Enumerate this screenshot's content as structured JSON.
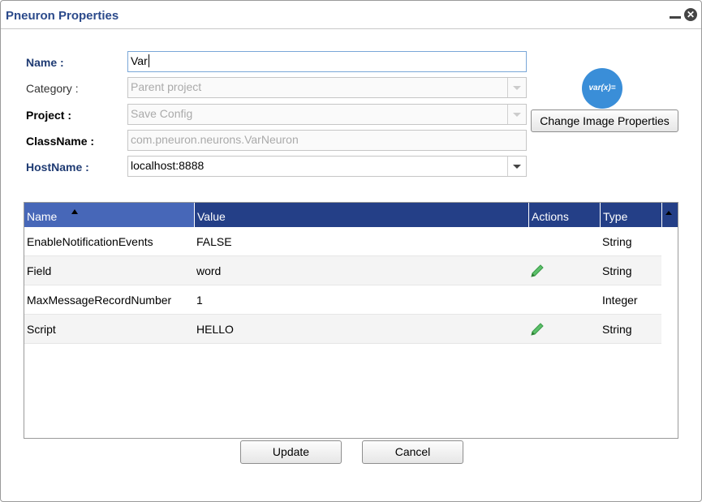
{
  "window": {
    "title": "Pneuron Properties"
  },
  "form": {
    "name_label": "Name :",
    "name_value": "Var",
    "category_label": "Category :",
    "category_value": "Parent project",
    "project_label": "Project :",
    "project_value": "Save Config",
    "classname_label": "ClassName :",
    "classname_value": "com.pneuron.neurons.VarNeuron",
    "hostname_label": "HostName :",
    "hostname_value": "localhost:8888"
  },
  "image": {
    "logo_text": "var(x)=",
    "change_button": "Change Image Properties"
  },
  "grid": {
    "columns": [
      "Name",
      "Value",
      "Actions",
      "Type"
    ],
    "sorted_column": "Name",
    "rows": [
      {
        "name": "EnableNotificationEvents",
        "value": "FALSE",
        "editable": false,
        "type": "String"
      },
      {
        "name": "Field",
        "value": "word",
        "editable": true,
        "type": "String"
      },
      {
        "name": "MaxMessageRecordNumber",
        "value": "1",
        "editable": false,
        "type": "Integer"
      },
      {
        "name": "Script",
        "value": "HELLO",
        "editable": true,
        "type": "String"
      }
    ]
  },
  "buttons": {
    "update": "Update",
    "cancel": "Cancel"
  },
  "colors": {
    "header": "#243f87",
    "title": "#2b4a8b",
    "edit_icon": "#4caf50"
  }
}
